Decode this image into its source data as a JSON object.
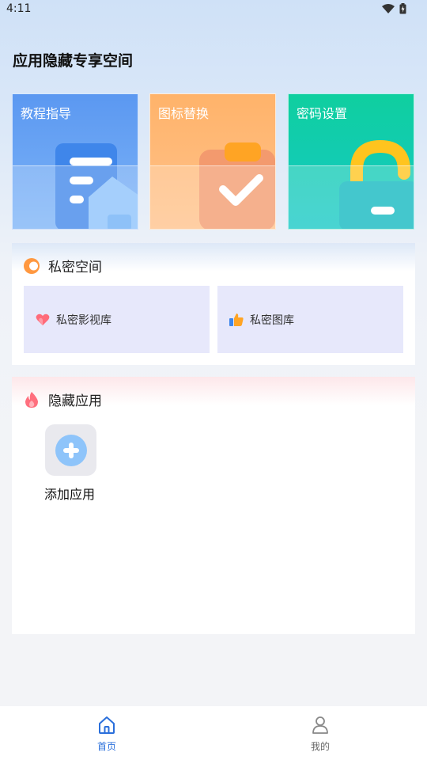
{
  "status_bar": {
    "time": "4:11"
  },
  "header": {
    "title": "应用隐藏专享空间"
  },
  "cards": [
    {
      "label": "教程指导",
      "icon": "tutorial-document-icon"
    },
    {
      "label": "图标替换",
      "icon": "clipboard-check-icon"
    },
    {
      "label": "密码设置",
      "icon": "lock-icon"
    }
  ],
  "private_space": {
    "title": "私密空间",
    "items": [
      {
        "label": "私密影视库",
        "icon": "heart-icon"
      },
      {
        "label": "私密图库",
        "icon": "thumbs-up-icon"
      }
    ]
  },
  "hidden_apps": {
    "title": "隐藏应用",
    "add_label": "添加应用"
  },
  "bottom_nav": [
    {
      "label": "首页",
      "active": true
    },
    {
      "label": "我的",
      "active": false
    }
  ],
  "colors": {
    "accent": "#2a6fdb",
    "card_blue": "#5b98f1",
    "card_orange": "#ffb36a",
    "card_teal": "#0fcf9f"
  }
}
